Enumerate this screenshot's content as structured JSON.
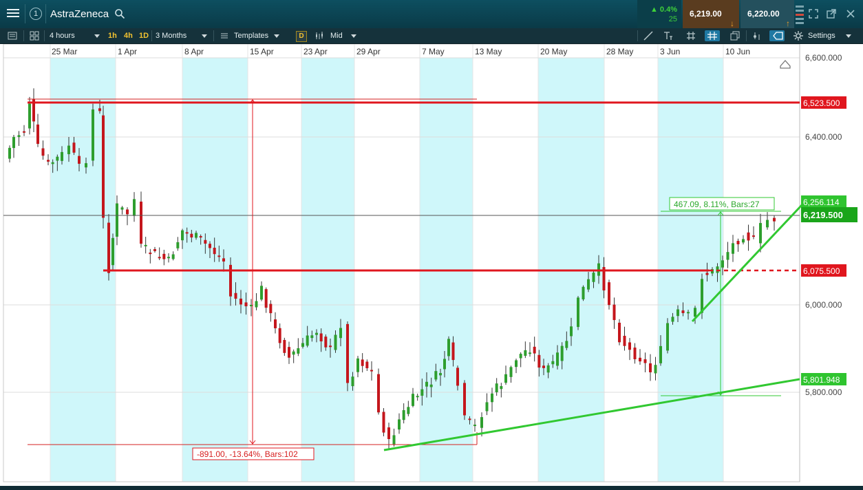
{
  "header": {
    "instrument": "AstraZeneca",
    "badge": "1",
    "change_pct": "0.4%",
    "change_pts": "25",
    "sell_price": "6,219.00",
    "buy_price": "6,220.00"
  },
  "toolbar": {
    "interval": "4 hours",
    "quick_1h": "1h",
    "quick_4h": "4h",
    "quick_1d": "1D",
    "range": "3 Months",
    "templates": "Templates",
    "d_label": "D",
    "price_type": "Mid",
    "settings": "Settings"
  },
  "chart": {
    "dates": [
      "25 Mar",
      "1 Apr",
      "8 Apr",
      "15 Apr",
      "23 Apr",
      "29 Apr",
      "7 May",
      "13 May",
      "20 May",
      "28 May",
      "3 Jun",
      "10 Jun"
    ],
    "price_ticks": [
      "6,600.000",
      "6,400.000",
      "6,000.000",
      "5,800.000"
    ],
    "level_high": "6,523.500",
    "level_trend_top": "6,256.114",
    "level_current": "6,219.500",
    "level_mid": "6,075.500",
    "level_trend_bottom": "5,801.948",
    "measure_down": "-891.00, -13.64%, Bars:102",
    "measure_up": "467.09, 8.11%, Bars:27",
    "colors": {
      "up": "#2e9e2e",
      "down": "#c4161c",
      "resistance": "#e0161e",
      "trend": "#31c831",
      "band": "#cff7fa"
    }
  }
}
